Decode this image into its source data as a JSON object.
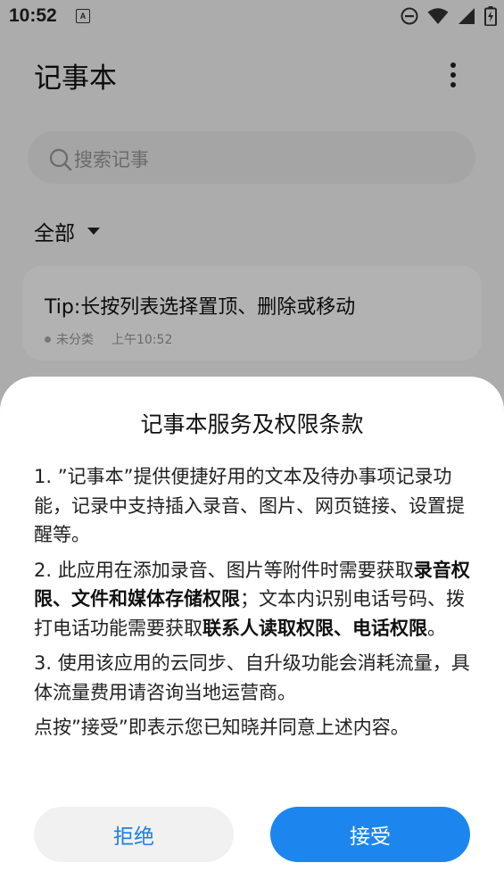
{
  "status_bar": {
    "time": "10:52",
    "notification_icon": "A",
    "icons": [
      "do-not-disturb-icon",
      "wifi-icon",
      "cell-signal-icon",
      "battery-charging-icon"
    ]
  },
  "app": {
    "title": "记事本",
    "search": {
      "placeholder": "搜索记事"
    },
    "filter": {
      "label": "全部"
    },
    "note": {
      "title": "Tip:长按列表选择置顶、删除或移动",
      "category": "未分类",
      "time": "上午10:52"
    }
  },
  "dialog": {
    "title": "记事本服务及权限条款",
    "p1": "1. ”记事本”提供便捷好用的文本及待办事项记录功能，记录中支持插入录音、图片、网页链接、设置提醒等。",
    "p2": {
      "part1": "2. 此应用在添加录音、图片等附件时需要获取",
      "bold1": "录音权限、文件和媒体存储权限",
      "part2": "；文本内识别电话号码、拨打电话功能需要获取",
      "bold2": "联系人读取权限、电话权限",
      "part3": "。"
    },
    "p3": "3. 使用该应用的云同步、自升级功能会消耗流量，具体流量费用请咨询当地运营商。",
    "p4": "点按”接受”即表示您已知晓并同意上述内容。",
    "reject_label": "拒绝",
    "accept_label": "接受"
  },
  "colors": {
    "accent": "#1c86ee",
    "scrim": "rgba(0,0,0,0.30)"
  }
}
